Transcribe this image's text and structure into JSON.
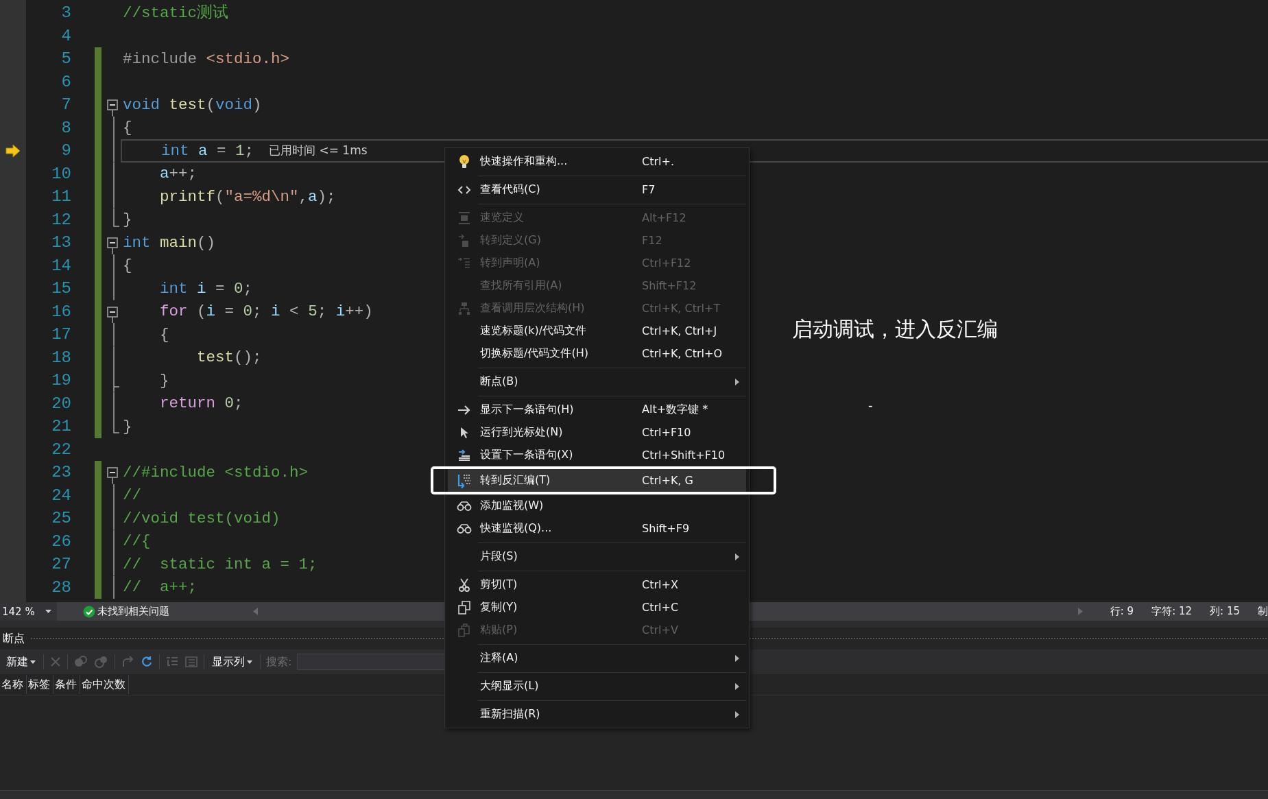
{
  "editor": {
    "lines": [
      {
        "number": "3",
        "changed": false,
        "current": false,
        "tokens": [
          {
            "text": "//static测试",
            "kind": "com"
          }
        ]
      },
      {
        "number": "4",
        "changed": false,
        "current": false
      },
      {
        "number": "5",
        "changed": true,
        "current": false,
        "tokens": [
          {
            "text": "#include",
            "kind": "pre"
          },
          {
            "text": " <stdio.h>",
            "kind": "str"
          }
        ]
      },
      {
        "number": "6",
        "changed": true,
        "current": false
      },
      {
        "number": "7",
        "changed": true,
        "current": false,
        "kind": "fold-open",
        "tokens": [
          {
            "text": "void",
            "kind": "kw"
          },
          {
            "text": " test",
            "kind": "fn"
          },
          {
            "text": "(",
            "kind": "punc"
          },
          {
            "text": "void",
            "kind": "kw"
          },
          {
            "text": ")",
            "kind": "punc"
          }
        ]
      },
      {
        "number": "8",
        "changed": true,
        "current": false,
        "kind": "fold-line",
        "tokens": [
          {
            "text": "{",
            "kind": "punc"
          }
        ]
      },
      {
        "number": "9",
        "changed": true,
        "current": true,
        "kind": "fold-line",
        "hint": "已用时间 <= 1ms",
        "tokens": [
          {
            "text": "    int",
            "kind": "kw"
          },
          {
            "text": " a",
            "kind": "var"
          },
          {
            "text": " = ",
            "kind": "punc"
          },
          {
            "text": "1",
            "kind": "num"
          },
          {
            "text": ";",
            "kind": "punc"
          }
        ]
      },
      {
        "number": "10",
        "changed": true,
        "current": false,
        "kind": "fold-line",
        "tokens": [
          {
            "text": "    a",
            "kind": "var"
          },
          {
            "text": "++;",
            "kind": "punc"
          }
        ]
      },
      {
        "number": "11",
        "changed": true,
        "current": false,
        "kind": "fold-line",
        "tokens": [
          {
            "text": "    printf",
            "kind": "fn"
          },
          {
            "text": "(",
            "kind": "punc"
          },
          {
            "text": "\"a=%d\\n\"",
            "kind": "str"
          },
          {
            "text": ",",
            "kind": "punc"
          },
          {
            "text": "a",
            "kind": "var"
          },
          {
            "text": ");",
            "kind": "punc"
          }
        ]
      },
      {
        "number": "12",
        "changed": true,
        "current": false,
        "kind": "fold-end",
        "tokens": [
          {
            "text": "}",
            "kind": "punc"
          }
        ]
      },
      {
        "number": "13",
        "changed": true,
        "current": false,
        "kind": "fold-open",
        "tokens": [
          {
            "text": "int",
            "kind": "kw"
          },
          {
            "text": " main",
            "kind": "fn"
          },
          {
            "text": "()",
            "kind": "punc"
          }
        ]
      },
      {
        "number": "14",
        "changed": true,
        "current": false,
        "kind": "fold-line",
        "tokens": [
          {
            "text": "{",
            "kind": "punc"
          }
        ]
      },
      {
        "number": "15",
        "changed": true,
        "current": false,
        "kind": "fold-line",
        "tokens": [
          {
            "text": "    int",
            "kind": "kw"
          },
          {
            "text": " i",
            "kind": "var"
          },
          {
            "text": " = ",
            "kind": "punc"
          },
          {
            "text": "0",
            "kind": "num"
          },
          {
            "text": ";",
            "kind": "punc"
          }
        ]
      },
      {
        "number": "16",
        "changed": true,
        "current": false,
        "kind": "fold-open",
        "tokens": [
          {
            "text": "    for",
            "kind": "ctl"
          },
          {
            "text": " (",
            "kind": "punc"
          },
          {
            "text": "i",
            "kind": "var"
          },
          {
            "text": " = ",
            "kind": "punc"
          },
          {
            "text": "0",
            "kind": "num"
          },
          {
            "text": "; ",
            "kind": "punc"
          },
          {
            "text": "i",
            "kind": "var"
          },
          {
            "text": " < ",
            "kind": "punc"
          },
          {
            "text": "5",
            "kind": "num"
          },
          {
            "text": "; ",
            "kind": "punc"
          },
          {
            "text": "i",
            "kind": "var"
          },
          {
            "text": "++)",
            "kind": "punc"
          }
        ]
      },
      {
        "number": "17",
        "changed": true,
        "current": false,
        "kind": "fold-line",
        "tokens": [
          {
            "text": "    {",
            "kind": "punc"
          }
        ]
      },
      {
        "number": "18",
        "changed": true,
        "current": false,
        "kind": "fold-line",
        "tokens": [
          {
            "text": "        test",
            "kind": "fn"
          },
          {
            "text": "();",
            "kind": "punc"
          }
        ]
      },
      {
        "number": "19",
        "changed": true,
        "current": false,
        "kind": "fold-branch",
        "tokens": [
          {
            "text": "    }",
            "kind": "punc"
          }
        ]
      },
      {
        "number": "20",
        "changed": true,
        "current": false,
        "kind": "fold-line",
        "tokens": [
          {
            "text": "    return",
            "kind": "ctl"
          },
          {
            "text": " 0",
            "kind": "num"
          },
          {
            "text": ";",
            "kind": "punc"
          }
        ]
      },
      {
        "number": "21",
        "changed": true,
        "current": false,
        "kind": "fold-end",
        "tokens": [
          {
            "text": "}",
            "kind": "punc"
          }
        ]
      },
      {
        "number": "22",
        "changed": false,
        "current": false
      },
      {
        "number": "23",
        "changed": true,
        "current": false,
        "kind": "fold-open",
        "tokens": [
          {
            "text": "//#include <stdio.h>",
            "kind": "com"
          }
        ]
      },
      {
        "number": "24",
        "changed": true,
        "current": false,
        "kind": "fold-line",
        "tokens": [
          {
            "text": "//",
            "kind": "com"
          }
        ]
      },
      {
        "number": "25",
        "changed": true,
        "current": false,
        "kind": "fold-line",
        "tokens": [
          {
            "text": "//void test(void)",
            "kind": "com"
          }
        ]
      },
      {
        "number": "26",
        "changed": true,
        "current": false,
        "kind": "fold-line",
        "tokens": [
          {
            "text": "//{",
            "kind": "com"
          }
        ]
      },
      {
        "number": "27",
        "changed": true,
        "current": false,
        "kind": "fold-line",
        "tokens": [
          {
            "text": "//  static int a = 1;",
            "kind": "com"
          }
        ]
      },
      {
        "number": "28",
        "changed": true,
        "current": false,
        "kind": "fold-line",
        "tokens": [
          {
            "text": "//  a++;",
            "kind": "com"
          }
        ]
      }
    ]
  },
  "context_menu": {
    "items": [
      {
        "kind": "item",
        "label": "快速操作和重构...",
        "shortcut": "Ctrl+.",
        "disabled": false,
        "selected": false,
        "submenu": false
      },
      {
        "kind": "separator"
      },
      {
        "kind": "item",
        "label": "查看代码(C)",
        "shortcut": "F7",
        "disabled": false,
        "selected": false,
        "submenu": false
      },
      {
        "kind": "separator"
      },
      {
        "kind": "item",
        "label": "速览定义",
        "shortcut": "Alt+F12",
        "disabled": true,
        "selected": false,
        "submenu": false
      },
      {
        "kind": "item",
        "label": "转到定义(G)",
        "shortcut": "F12",
        "disabled": true,
        "selected": false,
        "submenu": false
      },
      {
        "kind": "item",
        "label": "转到声明(A)",
        "shortcut": "Ctrl+F12",
        "disabled": true,
        "selected": false,
        "submenu": false
      },
      {
        "kind": "item",
        "label": "查找所有引用(A)",
        "shortcut": "Shift+F12",
        "disabled": true,
        "selected": false,
        "submenu": false
      },
      {
        "kind": "item",
        "label": "查看调用层次结构(H)",
        "shortcut": "Ctrl+K, Ctrl+T",
        "disabled": true,
        "selected": false,
        "submenu": false
      },
      {
        "kind": "item",
        "label": "速览标题(k)/代码文件",
        "shortcut": "Ctrl+K, Ctrl+J",
        "disabled": false,
        "selected": false,
        "submenu": false
      },
      {
        "kind": "item",
        "label": "切换标题/代码文件(H)",
        "shortcut": "Ctrl+K, Ctrl+O",
        "disabled": false,
        "selected": false,
        "submenu": false
      },
      {
        "kind": "separator"
      },
      {
        "kind": "item",
        "label": "断点(B)",
        "disabled": false,
        "selected": false,
        "submenu": true
      },
      {
        "kind": "separator"
      },
      {
        "kind": "item",
        "label": "显示下一条语句(H)",
        "shortcut": "Alt+数字键 *",
        "disabled": false,
        "selected": false,
        "submenu": false
      },
      {
        "kind": "item",
        "label": "运行到光标处(N)",
        "shortcut": "Ctrl+F10",
        "disabled": false,
        "selected": false,
        "submenu": false
      },
      {
        "kind": "item",
        "label": "设置下一条语句(X)",
        "shortcut": "Ctrl+Shift+F10",
        "disabled": false,
        "selected": false,
        "submenu": false
      },
      {
        "kind": "item",
        "label": "转到反汇编(T)",
        "shortcut": "Ctrl+K, G",
        "disabled": false,
        "selected": true,
        "submenu": false
      },
      {
        "kind": "item",
        "label": "添加监视(W)",
        "disabled": false,
        "selected": false,
        "submenu": false
      },
      {
        "kind": "item",
        "label": "快速监视(Q)...",
        "shortcut": "Shift+F9",
        "disabled": false,
        "selected": false,
        "submenu": false
      },
      {
        "kind": "separator"
      },
      {
        "kind": "item",
        "label": "片段(S)",
        "disabled": false,
        "selected": false,
        "submenu": true
      },
      {
        "kind": "separator"
      },
      {
        "kind": "item",
        "label": "剪切(T)",
        "shortcut": "Ctrl+X",
        "disabled": false,
        "selected": false,
        "submenu": false
      },
      {
        "kind": "item",
        "label": "复制(Y)",
        "shortcut": "Ctrl+C",
        "disabled": false,
        "selected": false,
        "submenu": false
      },
      {
        "kind": "item",
        "label": "粘贴(P)",
        "shortcut": "Ctrl+V",
        "disabled": true,
        "selected": false,
        "submenu": false
      },
      {
        "kind": "separator"
      },
      {
        "kind": "item",
        "label": "注释(A)",
        "disabled": false,
        "selected": false,
        "submenu": true
      },
      {
        "kind": "separator"
      },
      {
        "kind": "item",
        "label": "大纲显示(L)",
        "disabled": false,
        "selected": false,
        "submenu": true
      },
      {
        "kind": "separator"
      },
      {
        "kind": "item",
        "label": "重新扫描(R)",
        "disabled": false,
        "selected": false,
        "submenu": true
      }
    ]
  },
  "annotation": {
    "text": "启动调试，进入反汇编",
    "mark": "-"
  },
  "status_bar": {
    "zoom": "142 %",
    "issues": "未找到相关问题",
    "line": "行: 9",
    "char": "字符: 12",
    "column": "列: 15",
    "tab_mode": "制"
  },
  "breakpoints_panel": {
    "title": "断点",
    "new_button": "新建",
    "columns_button": "显示列",
    "search_label": "搜索:",
    "columns": [
      "名称",
      "标签",
      "条件",
      "命中次数"
    ]
  }
}
